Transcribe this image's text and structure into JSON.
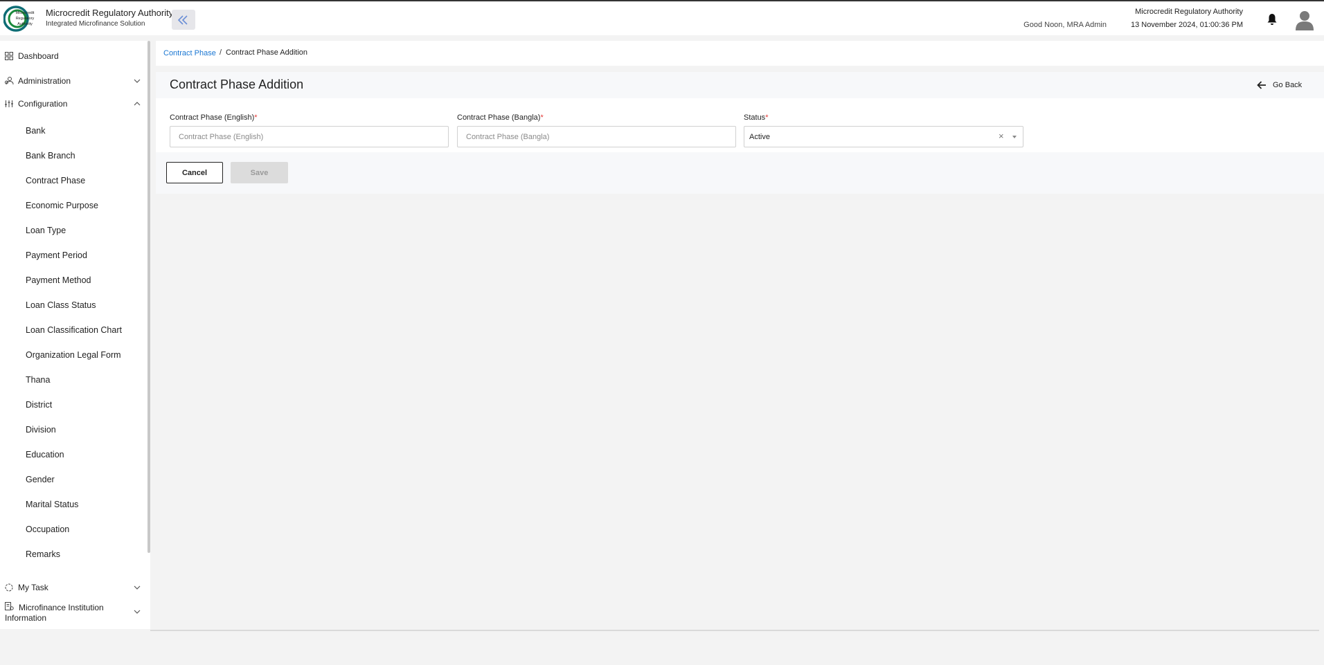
{
  "header": {
    "brand_title": "Microcredit Regulatory Authority",
    "brand_subtitle": "Integrated Microfinance Solution",
    "logo_text": "Microcredit Regulatory Authority",
    "greeting": "Good Noon, MRA Admin",
    "org_name": "Microcredit Regulatory Authority",
    "datetime": "13 November 2024, 01:00:36 PM",
    "icons": {
      "collapse": "double-chevron-left-icon",
      "notifications": "bell-icon",
      "profile": "user-avatar-icon"
    }
  },
  "sidebar": {
    "items": [
      {
        "label": "Dashboard",
        "icon": "grid-icon"
      },
      {
        "label": "Administration",
        "icon": "admin-icon",
        "expanded": false
      },
      {
        "label": "Configuration",
        "icon": "sliders-icon",
        "expanded": true
      }
    ],
    "config_sub_items": [
      "Bank",
      "Bank Branch",
      "Contract Phase",
      "Economic Purpose",
      "Loan Type",
      "Payment Period",
      "Payment Method",
      "Loan Class Status",
      "Loan Classification Chart",
      "Organization Legal Form",
      "Thana",
      "District",
      "Division",
      "Education",
      "Gender",
      "Marital Status",
      "Occupation",
      "Remarks"
    ],
    "bottom_items": [
      {
        "label": "My Task",
        "icon": "task-icon",
        "expanded": false
      },
      {
        "label": "Microfinance Institution Information",
        "icon": "institution-icon",
        "expanded": false
      }
    ]
  },
  "breadcrumb": {
    "parent": "Contract Phase",
    "separator": "/",
    "current": "Contract Phase Addition"
  },
  "page": {
    "title": "Contract Phase Addition",
    "go_back_label": "Go Back"
  },
  "form": {
    "english": {
      "label": "Contract Phase (English)",
      "required_mark": "*",
      "placeholder": "Contract Phase (English)",
      "value": ""
    },
    "bangla": {
      "label": "Contract Phase (Bangla)",
      "required_mark": "*",
      "placeholder": "Contract Phase (Bangla)",
      "value": ""
    },
    "status": {
      "label": "Status",
      "required_mark": "*",
      "value": "Active",
      "clear_glyph": "×"
    }
  },
  "actions": {
    "cancel_label": "Cancel",
    "save_label": "Save",
    "save_disabled": true
  },
  "colors": {
    "link": "#1976d2",
    "required": "#e53935",
    "logo_green": "#1a8a3c",
    "logo_teal": "#0e6d75"
  }
}
